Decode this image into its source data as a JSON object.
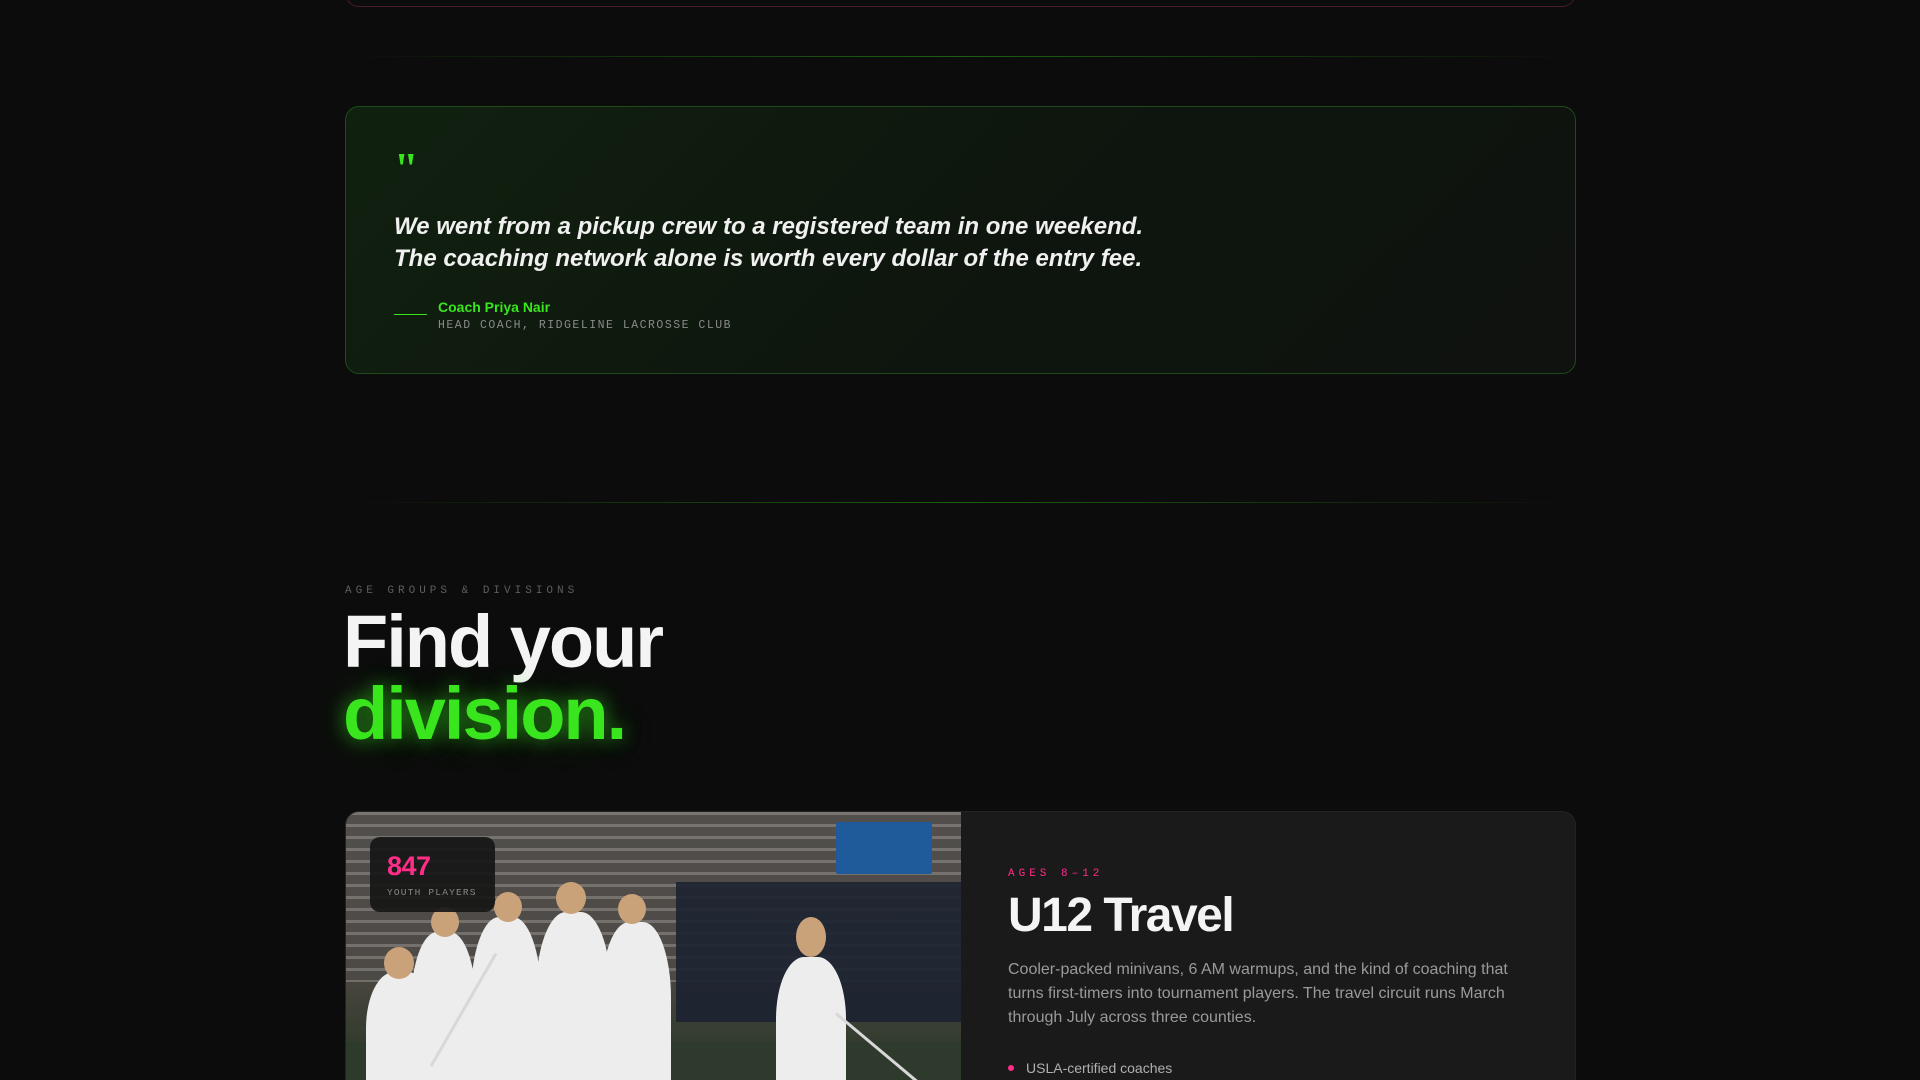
{
  "testimonial": {
    "quote_mark": "\"",
    "line1": "We went from a pickup crew to a registered team in one weekend.",
    "line2": "The coaching network alone is worth every dollar of the entry fee.",
    "author": "Coach Priya Nair",
    "role": "HEAD COACH, RIDGELINE LACROSSE CLUB"
  },
  "divisions_section": {
    "eyebrow": "AGE GROUPS & DIVISIONS",
    "heading_line1": "Find your",
    "heading_line2": "division."
  },
  "division_card": {
    "stat_value": "847",
    "stat_label": "YOUTH PLAYERS",
    "age_label": "AGES 8–12",
    "title": "U12 Travel",
    "description": "Cooler-packed minivans, 6 AM warmups, and the kind of coaching that turns first-timers into tournament players. The travel circuit runs March through July across three counties.",
    "features": [
      "USLA-certified coaches"
    ]
  },
  "colors": {
    "accent_green": "#39e61e",
    "accent_pink": "#ff2d87",
    "background": "#0c0c0c"
  }
}
